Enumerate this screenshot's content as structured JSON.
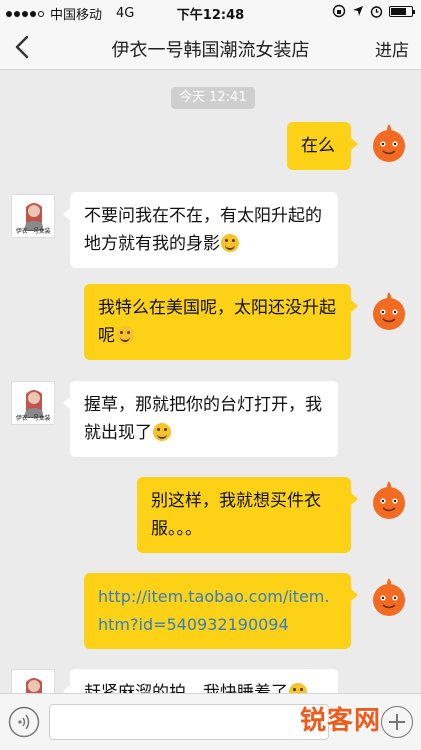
{
  "status_bar": {
    "carrier": "中国移动",
    "network": "4G",
    "time": "下午12:48"
  },
  "nav": {
    "title": "伊衣一号韩国潮流女装店",
    "right_action": "进店"
  },
  "chat": {
    "timestamp": "今天 12:41",
    "shop_avatar_label": "伊衣一号女装",
    "messages": [
      {
        "from": "me",
        "text": "在么"
      },
      {
        "from": "shop",
        "text": "不要问我在不在，有太阳升起的地方就有我的身影"
      },
      {
        "from": "me",
        "text": "我特么在美国呢，太阳还没升起呢"
      },
      {
        "from": "shop",
        "text": "握草，那就把你的台灯打开，我就出现了"
      },
      {
        "from": "me",
        "text": "别这样，我就想买件衣服。。。"
      },
      {
        "from": "me",
        "text": "http://item.taobao.com/item.htm?id=540932190094"
      },
      {
        "from": "shop",
        "text": "赶紧麻溜的拍，我快睡着了"
      }
    ]
  },
  "input_bar": {
    "placeholder": ""
  },
  "watermark": "锐客网",
  "colors": {
    "background": "#ebebeb",
    "bubble_out": "#fcd116",
    "bubble_in": "#ffffff",
    "link": "#2f7fc9"
  }
}
